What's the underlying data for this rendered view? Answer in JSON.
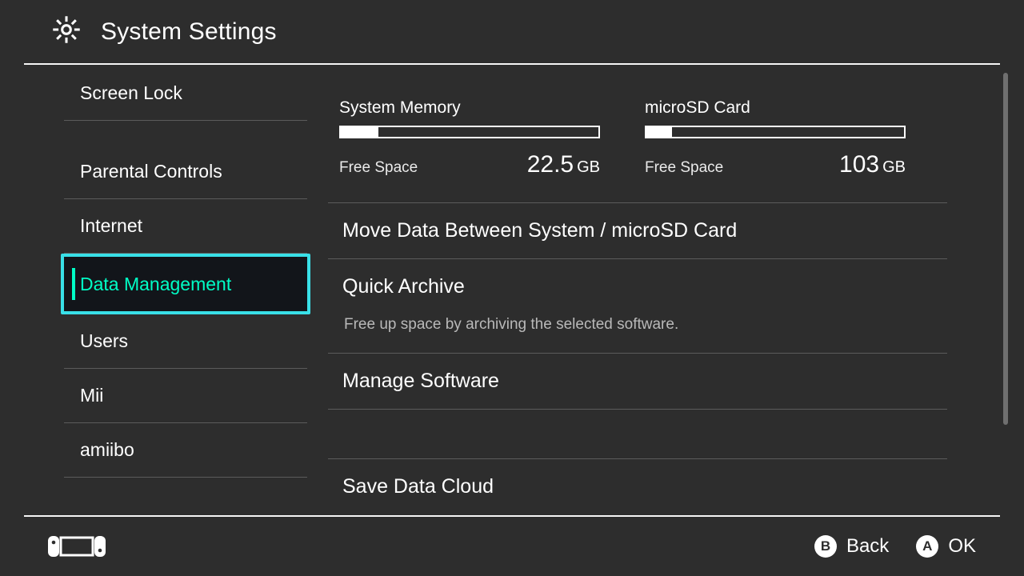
{
  "header": {
    "title": "System Settings"
  },
  "sidebar": {
    "items": [
      {
        "label": "Screen Lock",
        "selected": false,
        "sep_after": true
      },
      {
        "label": "Parental Controls",
        "selected": false
      },
      {
        "label": "Internet",
        "selected": false
      },
      {
        "label": "Data Management",
        "selected": true
      },
      {
        "label": "Users",
        "selected": false
      },
      {
        "label": "Mii",
        "selected": false
      },
      {
        "label": "amiibo",
        "selected": false
      }
    ]
  },
  "storage": {
    "free_label": "Free Space",
    "blocks": [
      {
        "name": "System Memory",
        "fill_percent": 14.5,
        "free_value": "22.5",
        "free_unit": "GB"
      },
      {
        "name": "microSD Card",
        "fill_percent": 10,
        "free_value": "103",
        "free_unit": "GB"
      }
    ]
  },
  "options": [
    {
      "title": "Move Data Between System / microSD Card"
    },
    {
      "title": "Quick Archive",
      "subtitle": "Free up space by archiving the selected software."
    },
    {
      "title": "Manage Software"
    },
    {
      "title": "Save Data Cloud"
    }
  ],
  "footer": {
    "buttons": [
      {
        "glyph": "B",
        "label": "Back"
      },
      {
        "glyph": "A",
        "label": "OK"
      }
    ]
  }
}
